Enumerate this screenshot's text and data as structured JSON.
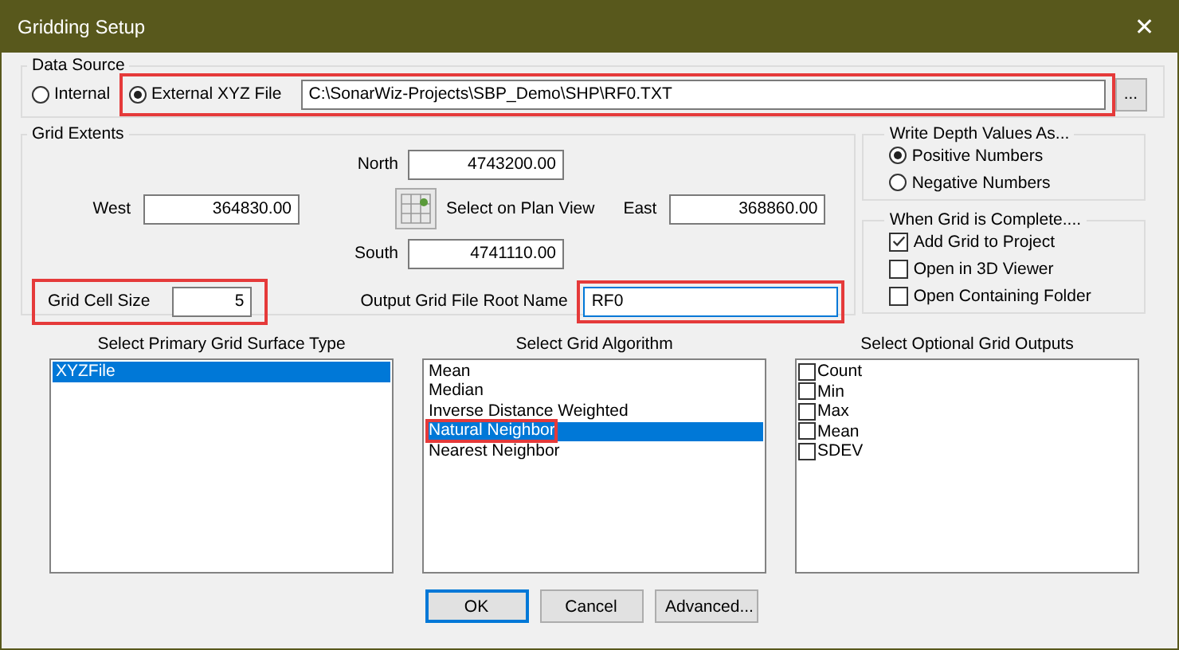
{
  "window": {
    "title": "Gridding Setup",
    "close": "✕"
  },
  "data_source": {
    "title": "Data Source",
    "options": [
      {
        "label": "Internal",
        "selected": false
      },
      {
        "label": "External XYZ File",
        "selected": true
      }
    ],
    "path": "C:\\SonarWiz-Projects\\SBP_Demo\\SHP\\RF0.TXT",
    "browse": "...",
    "highlighted": true
  },
  "grid_extents": {
    "title": "Grid Extents",
    "north": {
      "label": "North",
      "value": "4743200.00"
    },
    "west": {
      "label": "West",
      "value": "364830.00"
    },
    "east": {
      "label": "East",
      "value": "368860.00"
    },
    "south": {
      "label": "South",
      "value": "4741110.00"
    },
    "plan_view": "Select on Plan View",
    "cell_size": {
      "label": "Grid Cell Size",
      "value": "5",
      "highlighted": true
    },
    "output_name": {
      "label": "Output Grid File Root Name",
      "value": "RF0",
      "highlighted": true
    }
  },
  "write_depth": {
    "title": "Write Depth Values As...",
    "options": [
      {
        "label": "Positive Numbers",
        "selected": true
      },
      {
        "label": "Negative Numbers",
        "selected": false
      }
    ]
  },
  "when_complete": {
    "title": "When Grid is Complete....",
    "options": [
      {
        "label": "Add Grid to Project",
        "checked": true
      },
      {
        "label": "Open in 3D Viewer",
        "checked": false
      },
      {
        "label": "Open Containing Folder",
        "checked": false
      }
    ]
  },
  "surface_type": {
    "title": "Select Primary Grid Surface Type",
    "items": [
      {
        "label": "XYZFile",
        "selected": true,
        "highlighted": false
      }
    ]
  },
  "algorithm": {
    "title": "Select Grid Algorithm",
    "items": [
      {
        "label": "Mean",
        "selected": false,
        "highlighted": false
      },
      {
        "label": "Median",
        "selected": false,
        "highlighted": false
      },
      {
        "label": "Inverse Distance Weighted",
        "selected": false,
        "highlighted": false
      },
      {
        "label": "Natural Neighbor",
        "selected": true,
        "highlighted": true
      },
      {
        "label": "Nearest Neighbor",
        "selected": false,
        "highlighted": false
      }
    ]
  },
  "outputs": {
    "title": "Select Optional Grid Outputs",
    "items": [
      {
        "label": "Count",
        "checked": false
      },
      {
        "label": "Min",
        "checked": false
      },
      {
        "label": "Max",
        "checked": false
      },
      {
        "label": "Mean",
        "checked": false
      },
      {
        "label": "SDEV",
        "checked": false
      }
    ]
  },
  "buttons": [
    {
      "label": "OK",
      "default": true
    },
    {
      "label": "Cancel",
      "default": false
    },
    {
      "label": "Advanced...",
      "default": false
    }
  ]
}
